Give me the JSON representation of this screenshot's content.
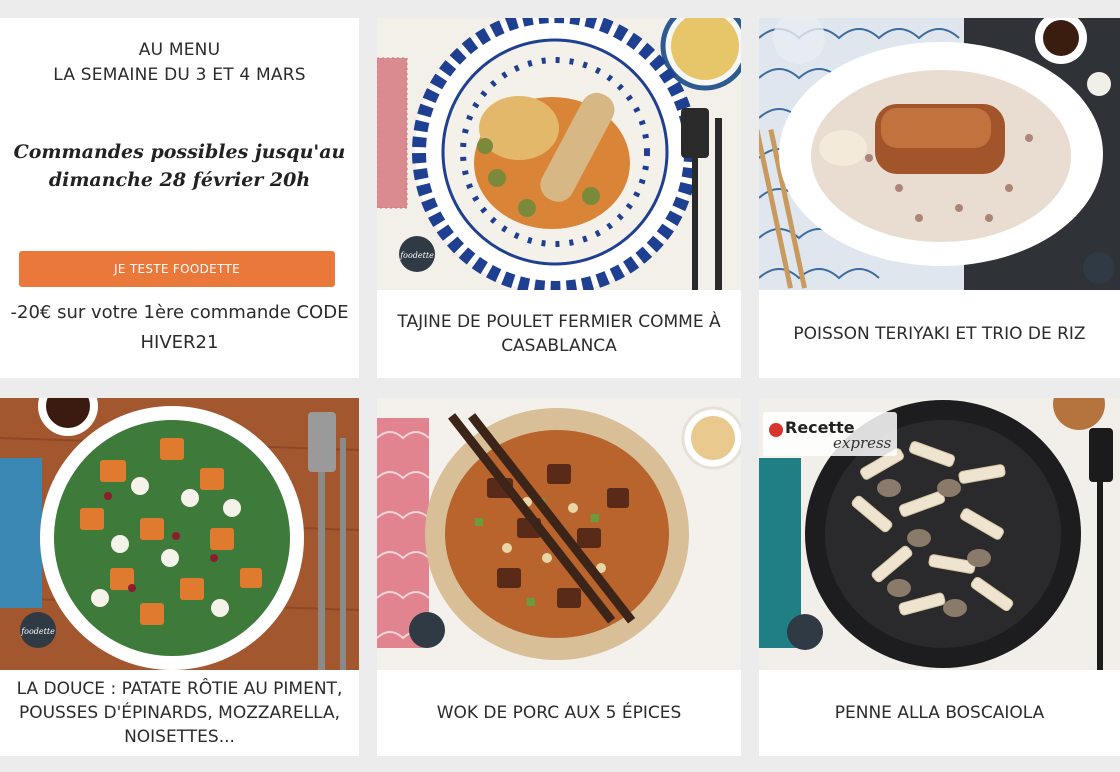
{
  "intro": {
    "title_line1": "AU MENU",
    "title_line2": "LA SEMAINE DU 3 ET 4 MARS",
    "deadline_line1": "Commandes possibles jusqu'au",
    "deadline_line2": "dimanche 28 février 20h",
    "cta_label": "JE TESTE FOODETTE",
    "promo_line1": "-20€ sur votre 1ère commande CODE",
    "promo_line2": "HIVER21"
  },
  "recipes": [
    {
      "title": "TAJINE DE POULET FERMIER COMME À CASABLANCA"
    },
    {
      "title": "POISSON TERIYAKI ET TRIO DE RIZ"
    },
    {
      "title": "LA DOUCE : PATATE RÔTIE AU PIMENT, POUSSES D'ÉPINARDS, MOZZARELLA, NOISETTES..."
    },
    {
      "title": "WOK DE PORC AUX 5 ÉPICES"
    },
    {
      "title": "PENNE ALLA BOSCAIOLA"
    }
  ],
  "badge": {
    "title": "Recette",
    "subtitle": "express"
  },
  "plate_logo": "foodette",
  "colors": {
    "accent": "#e9783a",
    "background": "#ececec",
    "card": "#ffffff"
  }
}
